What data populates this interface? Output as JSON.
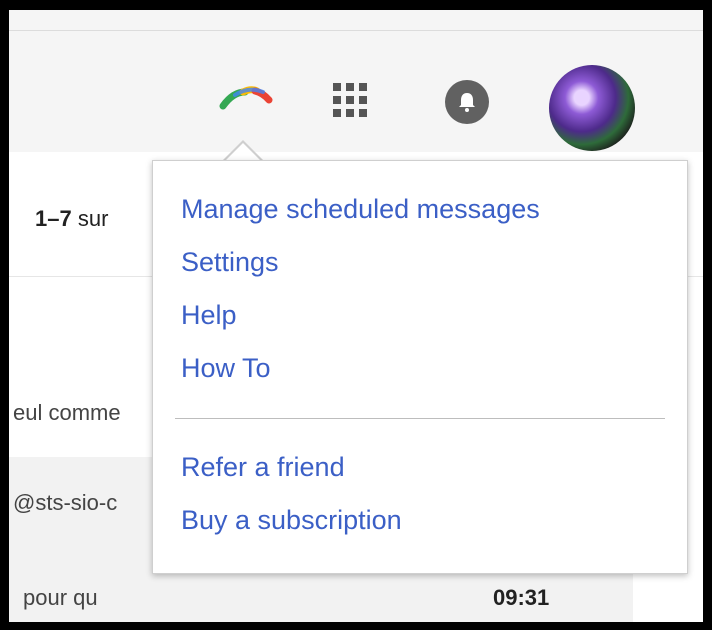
{
  "toolbar": {
    "icons": [
      "extension-rainbow-icon",
      "apps-grid-icon",
      "notification-bell-icon"
    ],
    "avatar": "user-avatar"
  },
  "pager": {
    "range": "1–7",
    "of": "sur"
  },
  "mail_rows": [
    {
      "snippet": "eul comme",
      "time": ""
    },
    {
      "snippet": "@sts-sio-c",
      "time": ""
    },
    {
      "snippet": "pour qu",
      "time": "09:31"
    }
  ],
  "menu": {
    "items": [
      "Manage scheduled messages",
      "Settings",
      "Help",
      "How To",
      "Refer a friend",
      "Buy a subscription"
    ]
  },
  "colors": {
    "link": "#3b5fc6",
    "header_bg": "#f5f5f5",
    "bell_bg": "#616161"
  }
}
